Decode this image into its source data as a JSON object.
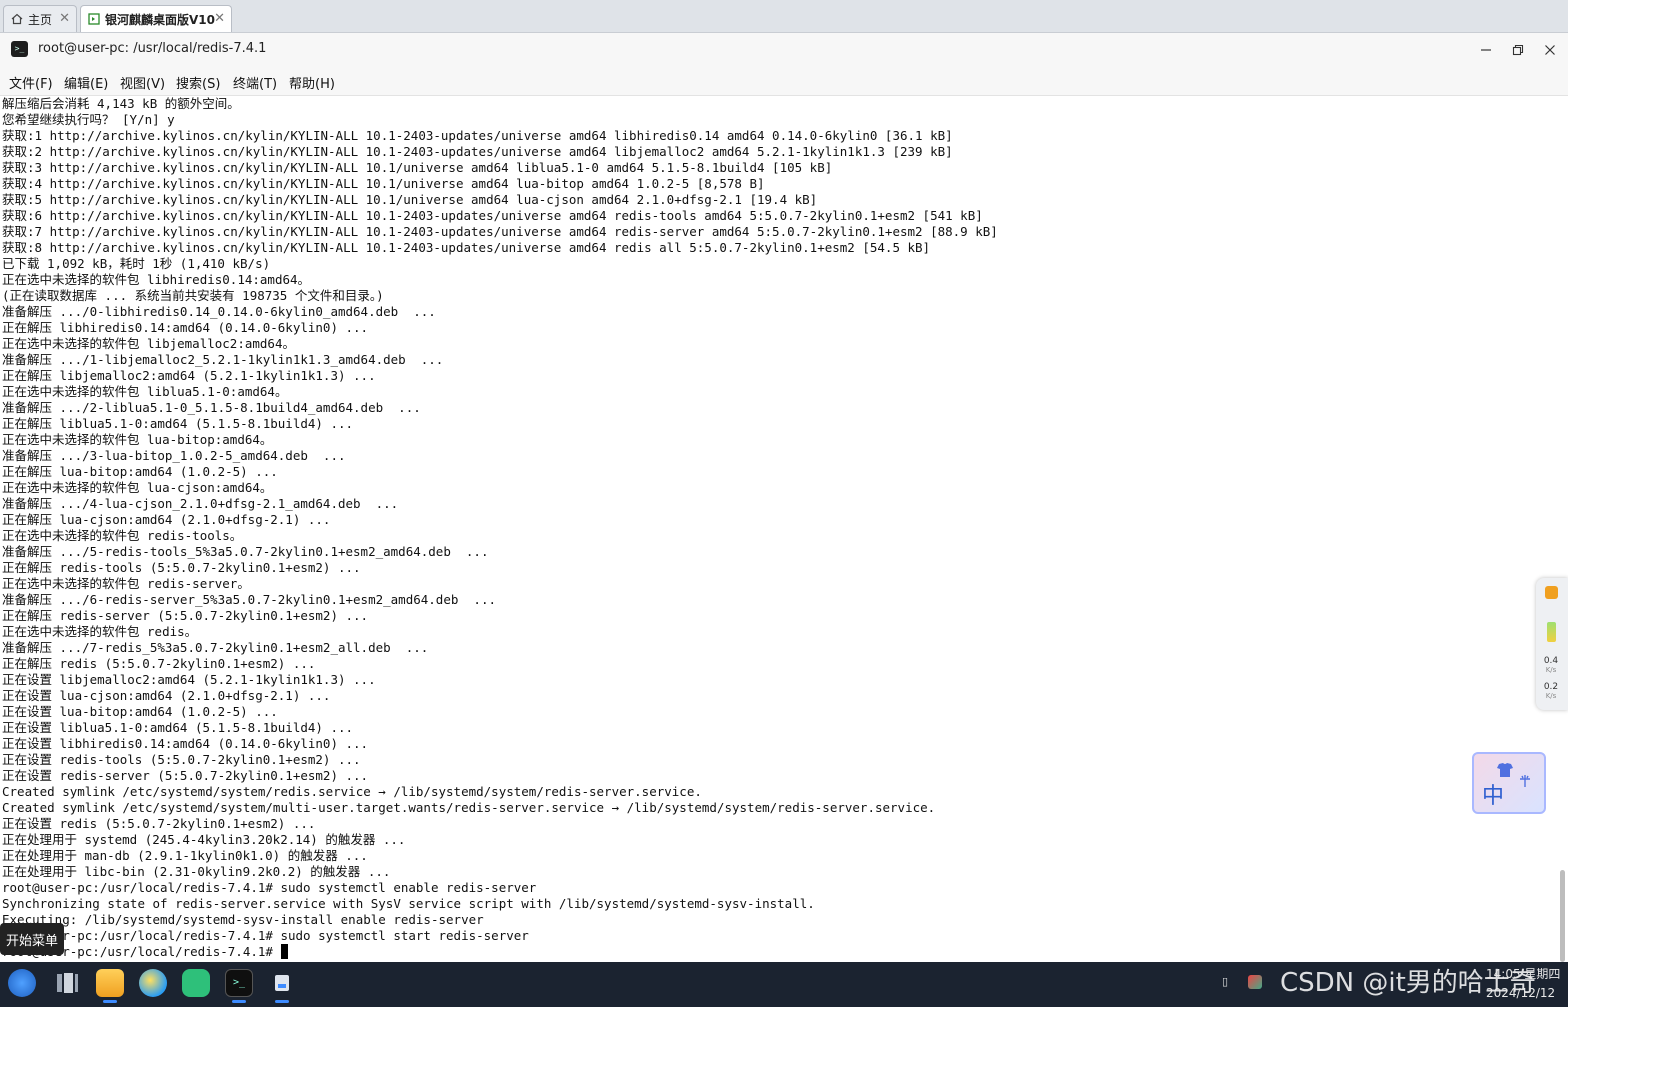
{
  "tabs": [
    {
      "label": "主页",
      "icon": "home-icon"
    },
    {
      "label": "银河麒麟桌面版V10",
      "icon": "terminal-tab-icon"
    }
  ],
  "window": {
    "title": "root@user-pc: /usr/local/redis-7.4.1"
  },
  "menu": [
    "文件(F)",
    "编辑(E)",
    "视图(V)",
    "搜索(S)",
    "终端(T)",
    "帮助(H)"
  ],
  "terminal": {
    "lines": [
      "解压缩后会消耗 4,143 kB 的额外空间。",
      "您希望继续执行吗？ [Y/n] y",
      "获取:1 http://archive.kylinos.cn/kylin/KYLIN-ALL 10.1-2403-updates/universe amd64 libhiredis0.14 amd64 0.14.0-6kylin0 [36.1 kB]",
      "获取:2 http://archive.kylinos.cn/kylin/KYLIN-ALL 10.1-2403-updates/universe amd64 libjemalloc2 amd64 5.2.1-1kylin1k1.3 [239 kB]",
      "获取:3 http://archive.kylinos.cn/kylin/KYLIN-ALL 10.1/universe amd64 liblua5.1-0 amd64 5.1.5-8.1build4 [105 kB]",
      "获取:4 http://archive.kylinos.cn/kylin/KYLIN-ALL 10.1/universe amd64 lua-bitop amd64 1.0.2-5 [8,578 B]",
      "获取:5 http://archive.kylinos.cn/kylin/KYLIN-ALL 10.1/universe amd64 lua-cjson amd64 2.1.0+dfsg-2.1 [19.4 kB]",
      "获取:6 http://archive.kylinos.cn/kylin/KYLIN-ALL 10.1-2403-updates/universe amd64 redis-tools amd64 5:5.0.7-2kylin0.1+esm2 [541 kB]",
      "获取:7 http://archive.kylinos.cn/kylin/KYLIN-ALL 10.1-2403-updates/universe amd64 redis-server amd64 5:5.0.7-2kylin0.1+esm2 [88.9 kB]",
      "获取:8 http://archive.kylinos.cn/kylin/KYLIN-ALL 10.1-2403-updates/universe amd64 redis all 5:5.0.7-2kylin0.1+esm2 [54.5 kB]",
      "已下载 1,092 kB，耗时 1秒 (1,410 kB/s)",
      "正在选中未选择的软件包 libhiredis0.14:amd64。",
      "(正在读取数据库 ... 系统当前共安装有 198735 个文件和目录。)",
      "准备解压 .../0-libhiredis0.14_0.14.0-6kylin0_amd64.deb  ...",
      "正在解压 libhiredis0.14:amd64 (0.14.0-6kylin0) ...",
      "正在选中未选择的软件包 libjemalloc2:amd64。",
      "准备解压 .../1-libjemalloc2_5.2.1-1kylin1k1.3_amd64.deb  ...",
      "正在解压 libjemalloc2:amd64 (5.2.1-1kylin1k1.3) ...",
      "正在选中未选择的软件包 liblua5.1-0:amd64。",
      "准备解压 .../2-liblua5.1-0_5.1.5-8.1build4_amd64.deb  ...",
      "正在解压 liblua5.1-0:amd64 (5.1.5-8.1build4) ...",
      "正在选中未选择的软件包 lua-bitop:amd64。",
      "准备解压 .../3-lua-bitop_1.0.2-5_amd64.deb  ...",
      "正在解压 lua-bitop:amd64 (1.0.2-5) ...",
      "正在选中未选择的软件包 lua-cjson:amd64。",
      "准备解压 .../4-lua-cjson_2.1.0+dfsg-2.1_amd64.deb  ...",
      "正在解压 lua-cjson:amd64 (2.1.0+dfsg-2.1) ...",
      "正在选中未选择的软件包 redis-tools。",
      "准备解压 .../5-redis-tools_5%3a5.0.7-2kylin0.1+esm2_amd64.deb  ...",
      "正在解压 redis-tools (5:5.0.7-2kylin0.1+esm2) ...",
      "正在选中未选择的软件包 redis-server。",
      "准备解压 .../6-redis-server_5%3a5.0.7-2kylin0.1+esm2_amd64.deb  ...",
      "正在解压 redis-server (5:5.0.7-2kylin0.1+esm2) ...",
      "正在选中未选择的软件包 redis。",
      "准备解压 .../7-redis_5%3a5.0.7-2kylin0.1+esm2_all.deb  ...",
      "正在解压 redis (5:5.0.7-2kylin0.1+esm2) ...",
      "正在设置 libjemalloc2:amd64 (5.2.1-1kylin1k1.3) ...",
      "正在设置 lua-cjson:amd64 (2.1.0+dfsg-2.1) ...",
      "正在设置 lua-bitop:amd64 (1.0.2-5) ...",
      "正在设置 liblua5.1-0:amd64 (5.1.5-8.1build4) ...",
      "正在设置 libhiredis0.14:amd64 (0.14.0-6kylin0) ...",
      "正在设置 redis-tools (5:5.0.7-2kylin0.1+esm2) ...",
      "正在设置 redis-server (5:5.0.7-2kylin0.1+esm2) ...",
      "Created symlink /etc/systemd/system/redis.service → /lib/systemd/system/redis-server.service.",
      "Created symlink /etc/systemd/system/multi-user.target.wants/redis-server.service → /lib/systemd/system/redis-server.service.",
      "正在设置 redis (5:5.0.7-2kylin0.1+esm2) ...",
      "正在处理用于 systemd (245.4-4kylin3.20k2.14) 的触发器 ...",
      "正在处理用于 man-db (2.9.1-1kylin0k1.0) 的触发器 ...",
      "正在处理用于 libc-bin (2.31-0kylin9.2k0.2) 的触发器 ...",
      "root@user-pc:/usr/local/redis-7.4.1# sudo systemctl enable redis-server",
      "Synchronizing state of redis-server.service with SysV service script with /lib/systemd/systemd-sysv-install.",
      "Executing: /lib/systemd/systemd-sysv-install enable redis-server",
      "root@user-pc:/usr/local/redis-7.4.1# sudo systemctl start redis-server",
      "root@user-pc:/usr/local/redis-7.4.1# "
    ]
  },
  "float_panel": {
    "up_speed": "0.4",
    "up_unit": "K/s",
    "down_speed": "0.2",
    "down_unit": "K/s"
  },
  "ime_widget": {
    "label": "中"
  },
  "start_tip": "开始菜单",
  "taskbar": {
    "apps": [
      "start-menu",
      "multitask-view",
      "file-manager",
      "browser",
      "chat-app",
      "terminal-app",
      "system-monitor"
    ],
    "clock_time": "14:05 星期四",
    "clock_date": "2024/12/12"
  },
  "watermark": "CSDN @it男的哈士奇",
  "colors": {
    "taskbar_bg": "#1b2330",
    "accent": "#3d8bff",
    "terminal_bg": "#ffffff",
    "text": "#111111"
  }
}
